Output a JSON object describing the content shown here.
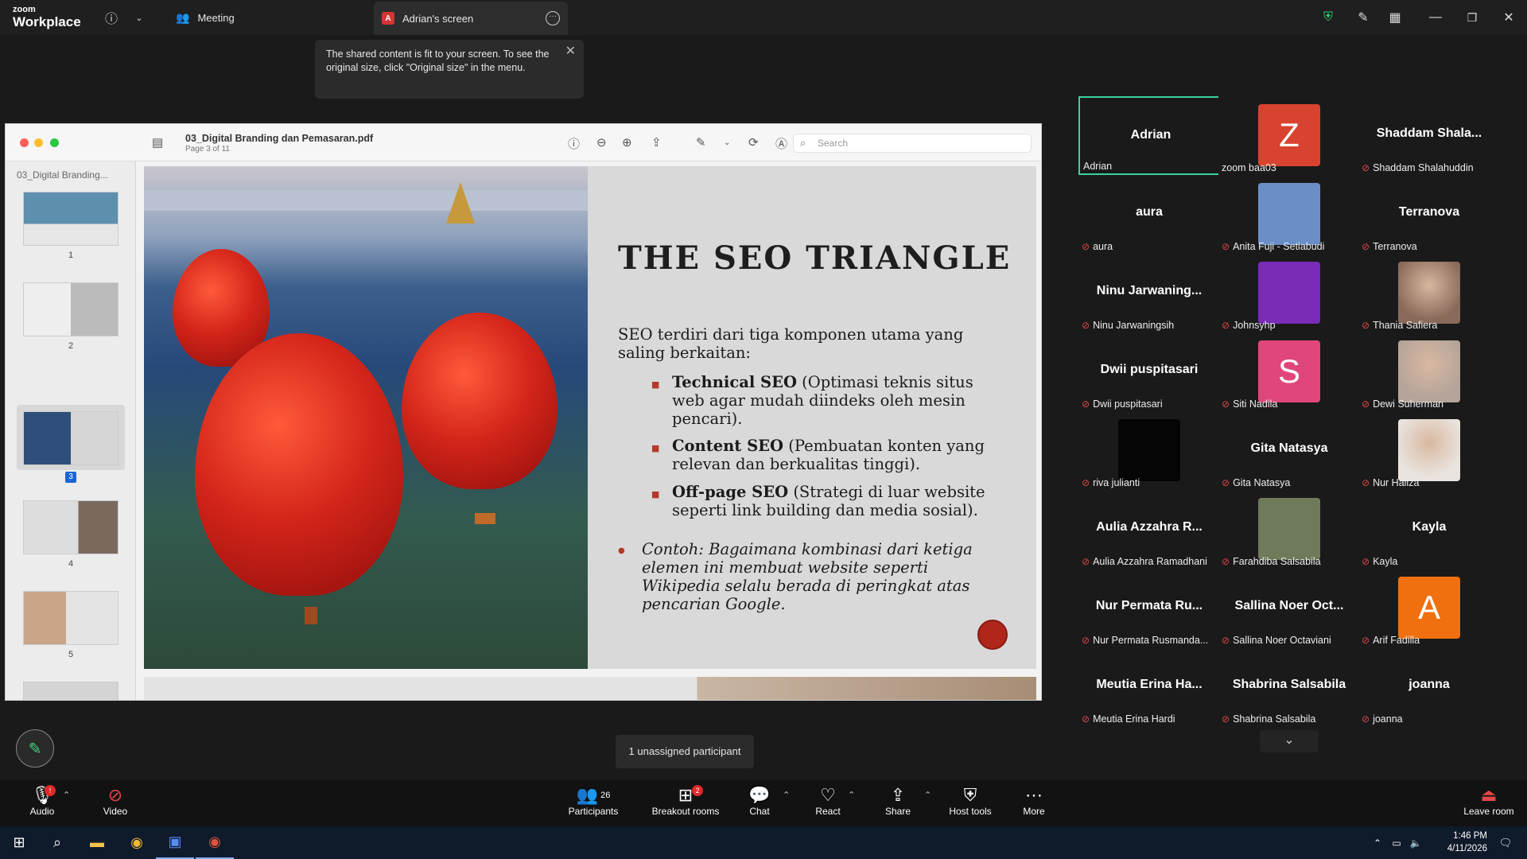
{
  "app": {
    "logo_line1": "zoom",
    "logo_line2": "Workplace"
  },
  "tabs": {
    "meeting": "Meeting",
    "screen": "Adrian's screen",
    "screen_badge": "A"
  },
  "toast": {
    "text": "The shared content is fit to your screen. To see the original size, click \"Original size\" in the menu."
  },
  "pdf": {
    "filename": "03_Digital Branding dan Pemasaran.pdf",
    "page_info": "Page 3 of 11",
    "search_placeholder": "Search",
    "sidebar_title": "03_Digital Branding...",
    "thumbnails": [
      "1",
      "2",
      "3",
      "4",
      "5"
    ]
  },
  "slide": {
    "title": "THE SEO TRIANGLE",
    "intro": "SEO terdiri dari tiga komponen utama yang saling berkaitan:",
    "bullets": [
      {
        "bold": "Technical SEO",
        "text": " (Optimasi teknis situs web agar mudah diindeks oleh mesin pencari)."
      },
      {
        "bold": "Content SEO",
        "text": " (Pembuatan konten yang relevan dan berkualitas tinggi)."
      },
      {
        "bold": "Off-page SEO",
        "text": " (Strategi di luar website seperti link building dan media sosial)."
      }
    ],
    "example": "Contoh: Bagaimana kombinasi dari ketiga elemen ini membuat website seperti Wikipedia selalu berada di peringkat atas pencarian Google."
  },
  "participants": [
    {
      "display": "Adrian",
      "label": "Adrian",
      "muted": false,
      "kind": "name",
      "active": true
    },
    {
      "display": "Z",
      "label": "zoom baa03",
      "muted": false,
      "kind": "letter",
      "color": "#d8432f"
    },
    {
      "display": "Shaddam  Shala...",
      "label": "Shaddam Shalahuddin",
      "muted": true,
      "kind": "name"
    },
    {
      "display": "aura",
      "label": "aura",
      "muted": true,
      "kind": "name"
    },
    {
      "display": "",
      "label": "Anita Fuji - Setiabudi",
      "muted": true,
      "kind": "photo",
      "color": "#6a8fc7"
    },
    {
      "display": "Terranova",
      "label": "Terranova",
      "muted": true,
      "kind": "name"
    },
    {
      "display": "Ninu  Jarwaning...",
      "label": "Ninu Jarwaningsih",
      "muted": true,
      "kind": "name"
    },
    {
      "display": "",
      "label": "Johnsyhp",
      "muted": true,
      "kind": "photo",
      "color": "#7a2bb8"
    },
    {
      "display": "",
      "label": "Thania Safiera",
      "muted": true,
      "kind": "photo",
      "color": "#8a6a5a"
    },
    {
      "display": "Dwii puspitasari",
      "label": "Dwii puspitasari",
      "muted": true,
      "kind": "name"
    },
    {
      "display": "S",
      "label": "Siti Nadila",
      "muted": true,
      "kind": "letter",
      "color": "#e0457b"
    },
    {
      "display": "",
      "label": "Dewi Suherman",
      "muted": true,
      "kind": "photo",
      "color": "#b5a49a"
    },
    {
      "display": "",
      "label": "riva julianti",
      "muted": true,
      "kind": "photo",
      "color": "#050505"
    },
    {
      "display": "Gita Natasya",
      "label": "Gita Natasya",
      "muted": true,
      "kind": "name"
    },
    {
      "display": "",
      "label": "Nur Haliza",
      "muted": true,
      "kind": "photo",
      "color": "#e9e4df"
    },
    {
      "display": "Aulia  Azzahra  R...",
      "label": "Aulia Azzahra Ramadhani",
      "muted": true,
      "kind": "name"
    },
    {
      "display": "",
      "label": "Farahdiba Salsabila",
      "muted": true,
      "kind": "photo",
      "color": "#6e7a5a"
    },
    {
      "display": "Kayla",
      "label": "Kayla",
      "muted": true,
      "kind": "name"
    },
    {
      "display": "Nur  Permata  Ru...",
      "label": "Nur Permata Rusmanda...",
      "muted": true,
      "kind": "name"
    },
    {
      "display": "Sallina  Noer  Oct...",
      "label": "Sallina Noer Octaviani",
      "muted": true,
      "kind": "name"
    },
    {
      "display": "A",
      "label": "Arif Fadilla",
      "muted": true,
      "kind": "letter",
      "color": "#f0700f"
    },
    {
      "display": "Meutia  Erina  Ha...",
      "label": "Meutia Erina Hardi",
      "muted": true,
      "kind": "name"
    },
    {
      "display": "Shabrina Salsabila",
      "label": "Shabrina Salsabila",
      "muted": true,
      "kind": "name"
    },
    {
      "display": "joanna",
      "label": "joanna",
      "muted": true,
      "kind": "name"
    }
  ],
  "unassigned": "1 unassigned participant",
  "toolbar": {
    "audio": "Audio",
    "video": "Video",
    "participants": "Participants",
    "participants_count": "26",
    "breakout": "Breakout rooms",
    "breakout_badge": "2",
    "chat": "Chat",
    "react": "React",
    "share": "Share",
    "host_tools": "Host tools",
    "more": "More",
    "leave": "Leave room"
  },
  "taskbar": {
    "time": "1:46 PM",
    "date": "4/11/2026"
  },
  "colors": {
    "accent_green": "#39d39b",
    "mute_red": "#e0484a",
    "toolbar_bg": "#121212"
  }
}
